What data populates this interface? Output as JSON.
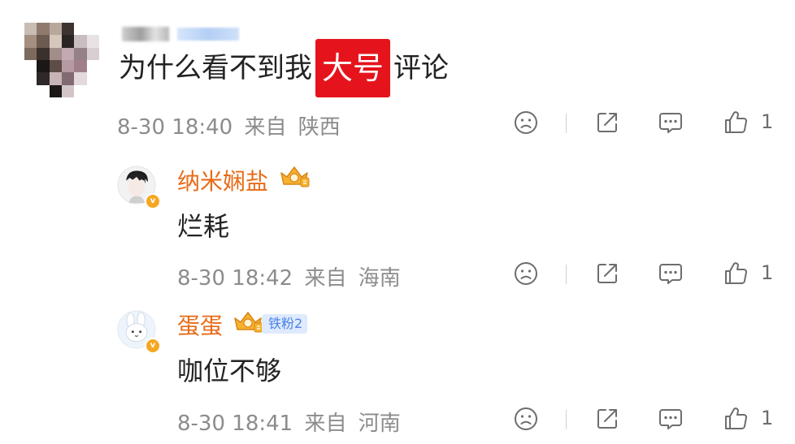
{
  "main_comment": {
    "text_before": "为什么看不到我",
    "text_highlight": "大号",
    "text_after": "评论",
    "date": "8-30 18:40",
    "from_label": "来自",
    "location": "陕西",
    "like_count": "1"
  },
  "replies": [
    {
      "username": "纳米娴盐",
      "text": "烂耗",
      "date": "8-30 18:42",
      "from_label": "来自",
      "location": "海南",
      "like_count": "1"
    },
    {
      "username": "蛋蛋",
      "fan_badge": "铁粉2",
      "text": "咖位不够",
      "date": "8-30 18:41",
      "from_label": "来自",
      "location": "河南",
      "like_count": "1"
    }
  ],
  "icons": {
    "dislike": "sad-face-icon",
    "share": "share-icon",
    "comment": "comment-icon",
    "like": "thumbs-up-icon",
    "crown": "crown-icon",
    "verified": "verified-badge-icon"
  },
  "colors": {
    "highlight": "#e5141c",
    "username": "#e86b17",
    "meta": "#8c8c8c",
    "icon": "#6d6d6d",
    "verified": "#f5a623",
    "fan_badge_bg": "#dfeafd",
    "fan_badge_text": "#4b82e6"
  }
}
